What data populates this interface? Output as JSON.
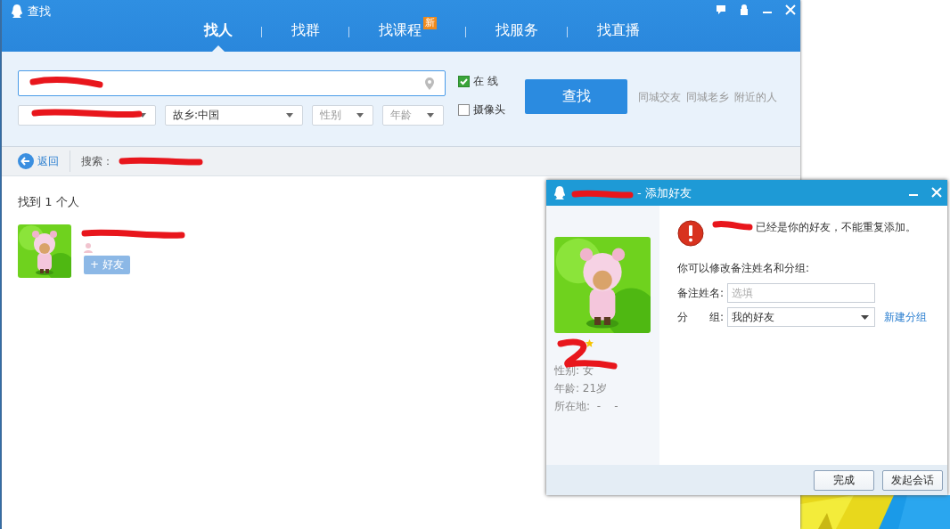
{
  "main_window": {
    "title": "查找",
    "tabs": [
      {
        "label": "找人",
        "selected": true
      },
      {
        "label": "找群",
        "selected": false
      },
      {
        "label": "找课程",
        "selected": false,
        "badge": "新"
      },
      {
        "label": "找服务",
        "selected": false
      },
      {
        "label": "找直播",
        "selected": false
      }
    ],
    "search": {
      "hometown": "故乡:中国",
      "gender_placeholder": "性别",
      "age_placeholder": "年龄",
      "online": {
        "label": "在 线",
        "checked": true
      },
      "camera": {
        "label": "摄像头",
        "checked": false
      },
      "button": "查找",
      "links": [
        "同城交友",
        "同城老乡",
        "附近的人"
      ]
    },
    "nav": {
      "back": "返回",
      "search_label": "搜索："
    },
    "results": {
      "summary": "找到 1 个人",
      "people": [
        {
          "add_button": "+ 好友"
        }
      ]
    }
  },
  "dialog": {
    "title": "- 添加好友",
    "message": "已经是你的好友，不能重复添加。",
    "prompt": "你可以修改备注姓名和分组:",
    "remark": {
      "label": "备注姓名:",
      "placeholder": "选填"
    },
    "group": {
      "label": "分　　组:",
      "value": "我的好友"
    },
    "new_group": "新建分组",
    "profile": {
      "details": [
        "性别: 女",
        "年龄: 21岁",
        "所在地:  -    -"
      ]
    },
    "buttons": [
      "完成",
      "发起会话"
    ]
  }
}
